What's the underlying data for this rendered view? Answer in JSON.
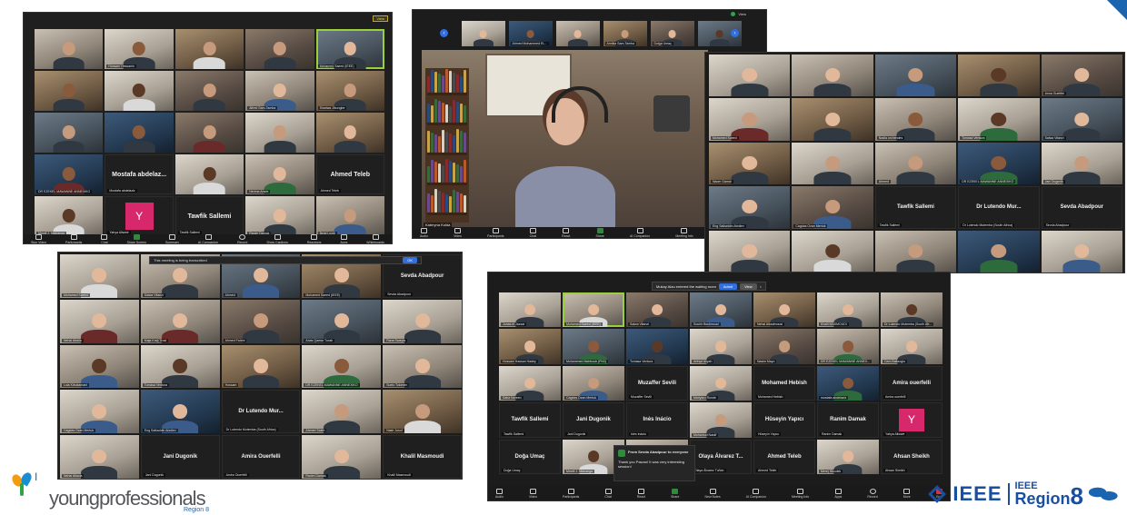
{
  "panel1": {
    "view_label": "View",
    "tiles": [
      {
        "type": "video",
        "label": "",
        "v": "v2",
        "tone": "",
        "shirt": ""
      },
      {
        "type": "video",
        "label": "Hossam Hessanin",
        "v": "v5",
        "tone": "tone2",
        "shirt": ""
      },
      {
        "type": "video",
        "label": "",
        "v": "v4",
        "tone": "",
        "shirt": "shirt4"
      },
      {
        "type": "video",
        "label": "",
        "v": "v1",
        "tone": "",
        "shirt": ""
      },
      {
        "type": "video",
        "label": "Mohamed Saeed (IEEE)",
        "v": "v3",
        "tone": "tone3",
        "shirt": "",
        "active": true
      },
      {
        "type": "video",
        "label": "",
        "v": "v4",
        "tone": "tone2",
        "shirt": ""
      },
      {
        "type": "video",
        "label": "",
        "v": "v5",
        "tone": "tone4",
        "shirt": "shirt4"
      },
      {
        "type": "video",
        "label": "",
        "v": "v1",
        "tone": "",
        "shirt": ""
      },
      {
        "type": "video",
        "label": "Alfred Sam-Tamba",
        "v": "v2",
        "tone": "tone3",
        "shirt": "shirt3"
      },
      {
        "type": "video",
        "label": "Shariwa Jibungbe",
        "v": "v4",
        "tone": "",
        "shirt": ""
      },
      {
        "type": "video",
        "label": "",
        "v": "v3",
        "tone": "",
        "shirt": ""
      },
      {
        "type": "video",
        "label": "",
        "v": "v6",
        "tone": "tone2",
        "shirt": ""
      },
      {
        "type": "video",
        "label": "",
        "v": "v1",
        "tone": "",
        "shirt": "shirt2"
      },
      {
        "type": "video",
        "label": "",
        "v": "v5",
        "tone": "",
        "shirt": ""
      },
      {
        "type": "video",
        "label": "",
        "v": "v4",
        "tone": "tone3",
        "shirt": ""
      },
      {
        "type": "video",
        "label": "DR EZEKEL MAWANNE ANNEXIKO",
        "v": "v6",
        "tone": "tone2",
        "shirt": "shirt2"
      },
      {
        "type": "name",
        "name": "Mostafa  abdelaz...",
        "label": "Mostafa abdelaziz"
      },
      {
        "type": "video",
        "label": "",
        "v": "v5",
        "tone": "tone4",
        "shirt": "shirt4"
      },
      {
        "type": "video",
        "label": "Nerima Amrie",
        "v": "v2",
        "tone": "tone3",
        "shirt": "shirt5"
      },
      {
        "type": "name",
        "name": "Ahmed Teleb",
        "label": "Ahmed Teleb"
      },
      {
        "type": "video",
        "label": "Mmeli J. Ntshanga",
        "v": "v5",
        "tone": "tone4",
        "shirt": "shirt4"
      },
      {
        "type": "yav",
        "letter": "Y",
        "label": "Yahya Aliwwe"
      },
      {
        "type": "name",
        "name": "Tawfik Sallemi",
        "label": "Tawfik Sallemi"
      },
      {
        "type": "video",
        "label": "Ranim Damak",
        "v": "v5",
        "tone": "tone3",
        "shirt": ""
      },
      {
        "type": "video",
        "label": "Belal Lozdi",
        "v": "v2",
        "tone": "",
        "shirt": "shirt3"
      }
    ],
    "toolbar": [
      "Stop Video",
      "Participants",
      "Chat",
      "Share Screen",
      "Summary",
      "AI Companion",
      "Record",
      "Show Captions",
      "Reactions",
      "Apps",
      "Whiteboards"
    ]
  },
  "panel2": {
    "top_labels": [
      "",
      "Ahmed Mohammed EL...",
      "",
      "Annika Sam-Tamba",
      "Dolga Umaç",
      ""
    ],
    "speaker_label": "Kateryna Kolda",
    "toolbar": [
      "Audio",
      "Video",
      "Participants",
      "Chat",
      "React",
      "Share",
      "AI Companion",
      "Meeting Info",
      "Apps",
      "More"
    ],
    "rec_label": "View"
  },
  "panel3": {
    "tiles": [
      {
        "type": "video",
        "label": "",
        "v": "v5",
        "tone": "tone3",
        "shirt": ""
      },
      {
        "type": "video",
        "label": "",
        "v": "v2",
        "tone": "tone3",
        "shirt": ""
      },
      {
        "type": "video",
        "label": "",
        "v": "v3",
        "tone": "",
        "shirt": "shirt3"
      },
      {
        "type": "video",
        "label": "",
        "v": "v4",
        "tone": "tone4",
        "shirt": ""
      },
      {
        "type": "video",
        "label": "Anna Guetifel",
        "v": "v1",
        "tone": "tone3",
        "shirt": ""
      },
      {
        "type": "video",
        "label": "Mohamed Saeed",
        "v": "v5",
        "tone": "",
        "shirt": "shirt2"
      },
      {
        "type": "video",
        "label": "",
        "v": "v4",
        "tone": "tone3",
        "shirt": ""
      },
      {
        "type": "video",
        "label": "Nadia orchendes",
        "v": "v2",
        "tone": "tone2",
        "shirt": ""
      },
      {
        "type": "video",
        "label": "Tomasa Ventura",
        "v": "v5",
        "tone": "tone4",
        "shirt": "shirt5"
      },
      {
        "type": "video",
        "label": "Salwa Vitanzi",
        "v": "v3",
        "tone": "tone3",
        "shirt": ""
      },
      {
        "type": "video",
        "label": "Naom Gamal",
        "v": "v4",
        "tone": "tone3",
        "shirt": ""
      },
      {
        "type": "video",
        "label": "",
        "v": "v5",
        "tone": "",
        "shirt": ""
      },
      {
        "type": "video",
        "label": "Ahmed",
        "v": "v2",
        "tone": "",
        "shirt": ""
      },
      {
        "type": "video",
        "label": "DR EZEKEL MAWANNE ANNEXIKO",
        "v": "v6",
        "tone": "tone2",
        "shirt": "shirt5"
      },
      {
        "type": "video",
        "label": "Jani Dugonik",
        "v": "v5",
        "tone": "",
        "shirt": ""
      },
      {
        "type": "video",
        "label": "Eng Salkaddin Aboliev",
        "v": "v3",
        "tone": "tone3",
        "shirt": ""
      },
      {
        "type": "video",
        "label": "Cagdas Ozan Mertuk",
        "v": "v1",
        "tone": "",
        "shirt": "shirt3"
      },
      {
        "type": "name",
        "name": "Tawfik Sallemi",
        "label": "Tawfik Sallemi"
      },
      {
        "type": "name",
        "name": "Dr Lutendo Mur...",
        "label": "Dr Lutendo Mutemba (South Africa)"
      },
      {
        "type": "name",
        "name": "Sevda Abadpour",
        "label": "Sevda Abadpour"
      },
      {
        "type": "video",
        "label": "",
        "v": "v5",
        "tone": "tone3",
        "shirt": ""
      },
      {
        "type": "video",
        "label": "",
        "v": "v5",
        "tone": "tone4",
        "shirt": "shirt4"
      },
      {
        "type": "video",
        "label": "",
        "v": "v2",
        "tone": "",
        "shirt": ""
      },
      {
        "type": "video",
        "label": "",
        "v": "v6",
        "tone": "",
        "shirt": "shirt5"
      },
      {
        "type": "video",
        "label": "",
        "v": "v5",
        "tone": "tone3",
        "shirt": "shirt3"
      }
    ]
  },
  "panel4": {
    "banner": "This meeting is being transcribed",
    "banner_btn": "OK",
    "tiles": [
      {
        "type": "video",
        "label": "Mohamed Saeed",
        "v": "v5",
        "tone": "tone3",
        "shirt": "shirt4"
      },
      {
        "type": "video",
        "label": "Salwa Vitanzi",
        "v": "v2",
        "tone": "tone3",
        "shirt": ""
      },
      {
        "type": "video",
        "label": "Ahmed",
        "v": "v3",
        "tone": "tone3",
        "shirt": "shirt3"
      },
      {
        "type": "video",
        "label": "Mohamed Saeed (IEEE)",
        "v": "v4",
        "tone": "tone3",
        "shirt": ""
      },
      {
        "type": "name",
        "name": "Sevda Abadpour",
        "label": "Sevda Abadpour"
      },
      {
        "type": "video",
        "label": "Nehal Attalla",
        "v": "v5",
        "tone": "tone3",
        "shirt": "shirt2"
      },
      {
        "type": "video",
        "label": "Maja Kralj Trost",
        "v": "v2",
        "tone": "tone3",
        "shirt": "shirt2"
      },
      {
        "type": "video",
        "label": "Ahmed Fahmi",
        "v": "v1",
        "tone": "",
        "shirt": ""
      },
      {
        "type": "video",
        "label": "Anas Qamar Turab",
        "v": "v3",
        "tone": "tone3",
        "shirt": ""
      },
      {
        "type": "video",
        "label": "Rana Swayta",
        "v": "v5",
        "tone": "tone3",
        "shirt": ""
      },
      {
        "type": "video",
        "label": "Lola Kibukamani",
        "v": "v2",
        "tone": "tone4",
        "shirt": "shirt3"
      },
      {
        "type": "video",
        "label": "Tomasa Ventura",
        "v": "v5",
        "tone": "tone4",
        "shirt": ""
      },
      {
        "type": "video",
        "label": "Hossam",
        "v": "v4",
        "tone": "tone3",
        "shirt": ""
      },
      {
        "type": "video",
        "label": "DR EZEKEL MAWANNE ANNEXIKO",
        "v": "v5",
        "tone": "tone2",
        "shirt": "shirt5"
      },
      {
        "type": "video",
        "label": "Suelo Tolomen",
        "v": "v2",
        "tone": "tone3",
        "shirt": ""
      },
      {
        "type": "video",
        "label": "Cagdas Ozan Mertuk",
        "v": "v5",
        "tone": "tone3",
        "shirt": "shirt3"
      },
      {
        "type": "video",
        "label": "Eng Salkaddin Aboliev",
        "v": "v6",
        "tone": "tone3",
        "shirt": "shirt3"
      },
      {
        "type": "name",
        "name": "Dr Lutendo Mur...",
        "label": "Dr Lutendo Mutemba (South Africa)"
      },
      {
        "type": "video",
        "label": "Ahmed Saleh",
        "v": "v5",
        "tone": "",
        "shirt": ""
      },
      {
        "type": "video",
        "label": "Nasir Jusuf",
        "v": "v4",
        "tone": "",
        "shirt": "shirt4"
      },
      {
        "type": "video",
        "label": "Nehal Atlasla",
        "v": "v5",
        "tone": "tone3",
        "shirt": ""
      },
      {
        "type": "name",
        "name": "Jani Dugonik",
        "label": "Jani Dugonik"
      },
      {
        "type": "name",
        "name": "Amira Ouerfelli",
        "label": "Amira Ouerfelli"
      },
      {
        "type": "video",
        "label": "Ranim Damak",
        "v": "v5",
        "tone": "tone3",
        "shirt": ""
      },
      {
        "type": "name",
        "name": "Khalil Masmoudi",
        "label": "Khalil Masmoudi"
      }
    ]
  },
  "panel5": {
    "notice_text": "Mukay Alau entered the waiting room",
    "admit_label": "Admit",
    "view_label": "View",
    "tiles": [
      {
        "type": "video",
        "label": "Jonas el Jazzar",
        "v": "v5",
        "tone": "tone3",
        "shirt": ""
      },
      {
        "type": "video",
        "label": "Mohamed Saeed (IEEE)",
        "v": "v2",
        "tone": "tone3",
        "shirt": "shirt4",
        "active": true
      },
      {
        "type": "video",
        "label": "Salwa Vitanzi",
        "v": "v1",
        "tone": "tone3",
        "shirt": ""
      },
      {
        "type": "video",
        "label": "Souhir Boulimoud",
        "v": "v3",
        "tone": "tone3",
        "shirt": "shirt3"
      },
      {
        "type": "video",
        "label": "Nehal Alkadmousi",
        "v": "v4",
        "tone": "tone3",
        "shirt": ""
      },
      {
        "type": "video",
        "label": "Khalil MASMOUDI",
        "v": "v5",
        "tone": "tone3",
        "shirt": ""
      },
      {
        "type": "video",
        "label": "Dr Lutendo Mutemba (South Afr...",
        "v": "v2",
        "tone": "tone4",
        "shirt": ""
      },
      {
        "type": "video",
        "label": "Hossam Hassan Hadey",
        "v": "v4",
        "tone": "tone3",
        "shirt": ""
      },
      {
        "type": "video",
        "label": "Mohammed Mahboub (PhD)",
        "v": "v3",
        "tone": "tone2",
        "shirt": "shirt5"
      },
      {
        "type": "video",
        "label": "Tomasa Ventura",
        "v": "v6",
        "tone": "tone4",
        "shirt": ""
      },
      {
        "type": "video",
        "label": "Arthyd Aliyah",
        "v": "v5",
        "tone": "tone3",
        "shirt": ""
      },
      {
        "type": "video",
        "label": "Nasim Mayo",
        "v": "v1",
        "tone": "",
        "shirt": ""
      },
      {
        "type": "video",
        "label": "DR EZEKEL MAWANNE ANNEX...",
        "v": "v2",
        "tone": "tone2",
        "shirt": "shirt5"
      },
      {
        "type": "video",
        "label": "Cem Baltaoglu",
        "v": "v5",
        "tone": "tone3",
        "shirt": ""
      },
      {
        "type": "video",
        "label": "Saba Noreen",
        "v": "v5",
        "tone": "tone3",
        "shirt": ""
      },
      {
        "type": "video",
        "label": "Cagdas Ozan Mertuk",
        "v": "v2",
        "tone": "",
        "shirt": "shirt3"
      },
      {
        "type": "name",
        "name": "Muzaffer Sevili",
        "label": "Muzaffer Sevili"
      },
      {
        "type": "video",
        "label": "Mariyaru Ronde",
        "v": "v5",
        "tone": "tone3",
        "shirt": ""
      },
      {
        "type": "name",
        "name": "Mohamed Hebish",
        "label": "Mohamed Hebish"
      },
      {
        "type": "video",
        "label": "mostafa abdelaziz",
        "v": "v6",
        "tone": "tone2",
        "shirt": "shirt5"
      },
      {
        "type": "name",
        "name": "Amira ouerfelli",
        "label": "Amira ouerfelli"
      },
      {
        "type": "name",
        "name": "Tawfik Sallemi",
        "label": "Tawfik Sallemi"
      },
      {
        "type": "name",
        "name": "Jani Dugonik",
        "label": "Jani Dugonik"
      },
      {
        "type": "name",
        "name": "Inès Inácio",
        "label": "Inès Inácio"
      },
      {
        "type": "video",
        "label": "Mohamud Nasiif",
        "v": "v5",
        "tone": "",
        "shirt": ""
      },
      {
        "type": "name",
        "name": "Hüseyin Yapıcı",
        "label": "Hüseyin Yapıcı"
      },
      {
        "type": "name",
        "name": "Ranim Damak",
        "label": "Ranim Damak"
      },
      {
        "type": "yav",
        "letter": "Y",
        "label": "Yahya Aliwwe"
      },
      {
        "type": "name",
        "name": "Doğa Umaç",
        "label": "Doğa Umaç"
      },
      {
        "type": "video",
        "label": "Mmeli J. Ntshanga",
        "v": "v5",
        "tone": "tone4",
        "shirt": "shirt4"
      },
      {
        "type": "video",
        "label": "",
        "v": "v2",
        "tone": "tone3",
        "shirt": ""
      },
      {
        "type": "name",
        "name": "Olaya Álvarez T...",
        "label": "Olaya Álvarez Tuñón"
      },
      {
        "type": "name",
        "name": "Ahmed Teleb",
        "label": "Ahmed Teleb"
      },
      {
        "type": "video",
        "label": "Merej Skoulek",
        "v": "v5",
        "tone": "tone3",
        "shirt": ""
      },
      {
        "type": "name",
        "name": "Ahsan Sheikh",
        "label": "Ahsan Sheikh"
      }
    ],
    "chat_from": "From Sevda Abadpour to everyone",
    "chat_msg": "Thank you Pawan! It was very interesting session!",
    "toolbar": [
      "Audio",
      "Video",
      "Participants",
      "Chat",
      "React",
      "Share",
      "New Notes",
      "AI Companion",
      "Meeting Info",
      "Apps",
      "Record",
      "More"
    ],
    "end_label": "End"
  },
  "branding": {
    "yp_prefix": "I",
    "yp_text": "youngprofessionals",
    "yp_region": "Region 8",
    "ieee": "IEEE",
    "ieee_small": "IEEE",
    "region": "Region",
    "region_num": "8"
  }
}
